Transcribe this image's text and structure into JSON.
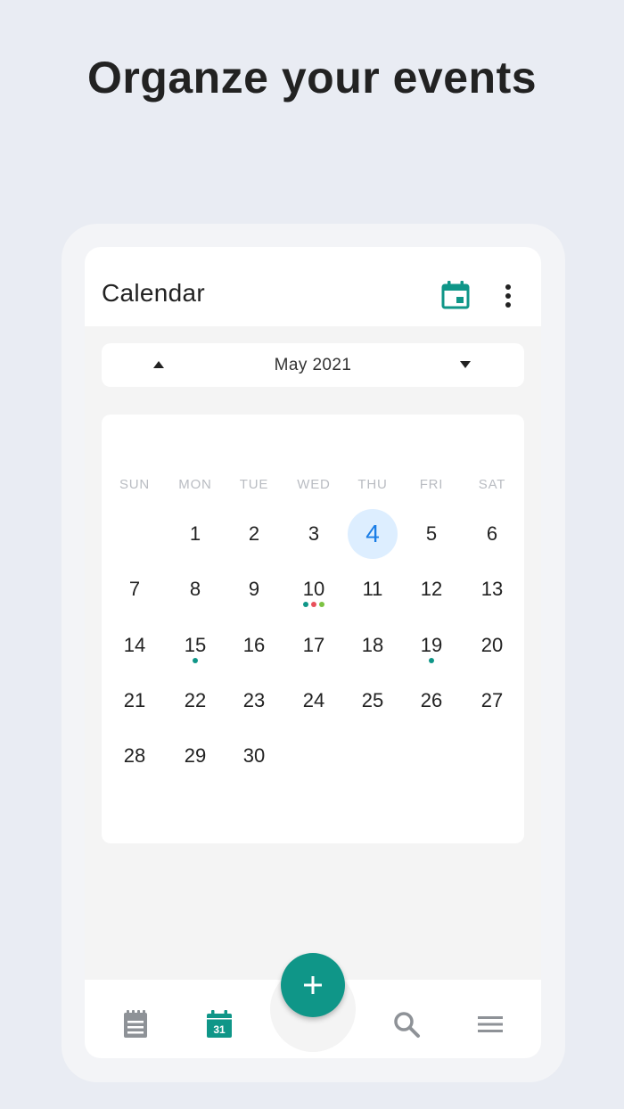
{
  "headline": "Organze your events",
  "app": {
    "title": "Calendar"
  },
  "icons": {
    "calendar_today": "calendar-icon",
    "more": "more-vert-icon",
    "prev": "triangle-up-icon",
    "next": "triangle-down-icon",
    "add": "plus-icon",
    "notes": "notepad-icon",
    "calendar_tab": "calendar-31-icon",
    "search": "search-icon",
    "menu": "hamburger-icon"
  },
  "month_nav": {
    "label": "May 2021"
  },
  "weekdays": [
    "SUN",
    "MON",
    "TUE",
    "WED",
    "THU",
    "FRI",
    "SAT"
  ],
  "days": [
    "",
    "1",
    "2",
    "3",
    "4",
    "5",
    "6",
    "7",
    "8",
    "9",
    "10",
    "11",
    "12",
    "13",
    "14",
    "15",
    "16",
    "17",
    "18",
    "19",
    "20",
    "21",
    "22",
    "23",
    "24",
    "25",
    "26",
    "27",
    "28",
    "29",
    "30",
    "",
    "",
    "",
    ""
  ],
  "today": "4",
  "events": {
    "10": [
      "#0f9688",
      "#e8505b",
      "#7cc242"
    ],
    "15": [
      "#0f9688"
    ],
    "19": [
      "#0f9688"
    ]
  },
  "bottom_nav": {
    "calendar_day": "31",
    "active_tab": "calendar"
  },
  "colors": {
    "accent": "#0f9688",
    "today_bg": "#ddeeff",
    "today_text": "#1a7de6",
    "inactive_icon": "#8e9297"
  }
}
